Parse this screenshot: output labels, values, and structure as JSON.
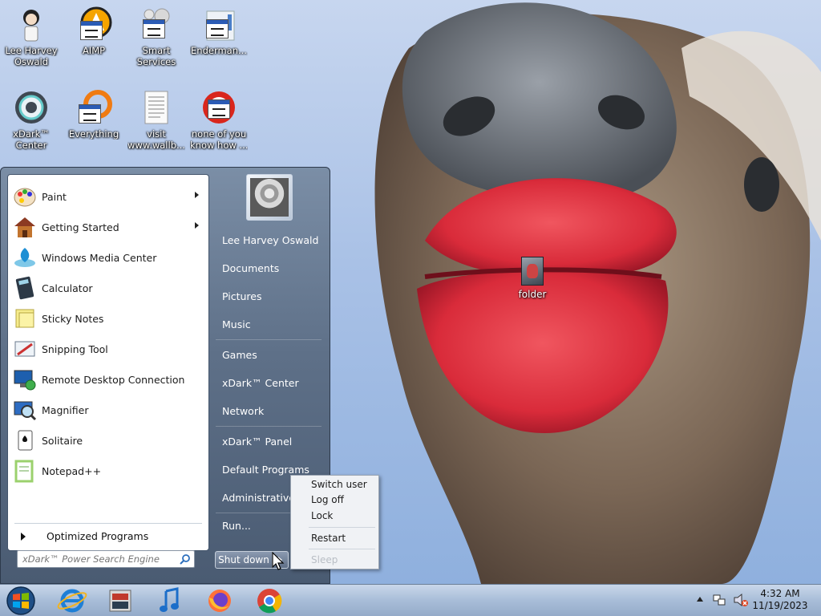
{
  "desktop_icons": [
    {
      "label_lines": [
        "Lee Harvey",
        "Oswald"
      ],
      "icon": "user-figure-icon"
    },
    {
      "label_lines": [
        "AIMP"
      ],
      "icon": "aimp-icon"
    },
    {
      "label_lines": [
        "Smart",
        "Services"
      ],
      "icon": "smart-services-icon"
    },
    {
      "label_lines": [
        "Enderman..."
      ],
      "icon": "enderman-icon"
    },
    {
      "label_lines": [
        "xDark™",
        "Center"
      ],
      "icon": "xdark-center-icon"
    },
    {
      "label_lines": [
        "Everything"
      ],
      "icon": "everything-icon"
    },
    {
      "label_lines": [
        "visit",
        "www.wallb..."
      ],
      "icon": "document-icon"
    },
    {
      "label_lines": [
        "none of you",
        "know how ..."
      ],
      "icon": "shortcut-icon"
    }
  ],
  "desktop_folder": {
    "label": "folder"
  },
  "start_menu": {
    "programs": [
      {
        "name": "Paint",
        "has_submenu": true,
        "icon": "paint-icon"
      },
      {
        "name": "Getting Started",
        "has_submenu": true,
        "icon": "getting-started-icon"
      },
      {
        "name": "Windows Media Center",
        "has_submenu": false,
        "icon": "media-center-icon"
      },
      {
        "name": "Calculator",
        "has_submenu": false,
        "icon": "calculator-icon"
      },
      {
        "name": "Sticky Notes",
        "has_submenu": false,
        "icon": "sticky-notes-icon"
      },
      {
        "name": "Snipping Tool",
        "has_submenu": false,
        "icon": "snipping-tool-icon"
      },
      {
        "name": "Remote Desktop Connection",
        "has_submenu": false,
        "icon": "remote-desktop-icon"
      },
      {
        "name": "Magnifier",
        "has_submenu": false,
        "icon": "magnifier-icon"
      },
      {
        "name": "Solitaire",
        "has_submenu": false,
        "icon": "solitaire-icon"
      },
      {
        "name": "Notepad++",
        "has_submenu": false,
        "icon": "notepadpp-icon"
      }
    ],
    "all_programs_label": "Optimized Programs",
    "search_placeholder": "xDark™ Power Search Engine",
    "right_items": [
      "Lee Harvey Oswald",
      "Documents",
      "Pictures",
      "Music",
      "Games",
      "xDark™ Center",
      "Network",
      "xDark™ Panel",
      "Default Programs",
      "Administrative Tools",
      "Run..."
    ],
    "shutdown_label": "Shut down"
  },
  "shutdown_flyout": {
    "items": [
      "Switch user",
      "Log off",
      "Lock",
      "Restart",
      "Sleep"
    ],
    "disabled": [
      "Sleep"
    ]
  },
  "taskbar": {
    "pinned": [
      "internet-explorer-icon",
      "media-app-icon",
      "music-note-icon",
      "firefox-icon",
      "chrome-icon"
    ],
    "clock_time": "4:32 AM",
    "clock_date": "11/19/2023"
  }
}
